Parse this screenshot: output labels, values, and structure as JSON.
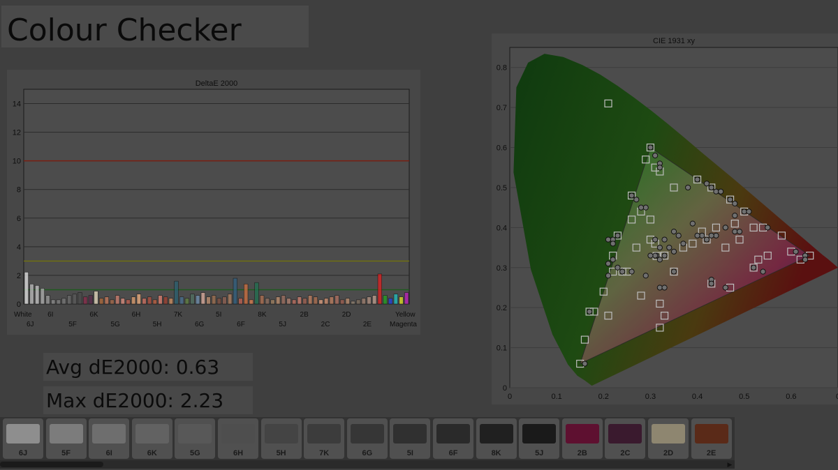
{
  "page_title": "Colour Checker",
  "stats": {
    "avg_label": "Avg dE2000: 0.63",
    "max_label": "Max dE2000: 2.23"
  },
  "chart_data": [
    {
      "type": "bar",
      "title": "DeltaE 2000",
      "ylim": [
        0,
        15
      ],
      "yticks": [
        0,
        2,
        4,
        6,
        8,
        10,
        12,
        14
      ],
      "grid": true,
      "reference_lines": [
        {
          "value": 10,
          "color": "#7a1f12"
        },
        {
          "value": 3,
          "color": "#6f6f12"
        },
        {
          "value": 1,
          "color": "#1f5a1f"
        }
      ],
      "first_label": "White",
      "last_labels": [
        "Yellow",
        "Magenta"
      ],
      "visible_tick_labels": [
        "6J",
        "6I",
        "5F",
        "6K",
        "5G",
        "6H",
        "5H",
        "7K",
        "6G",
        "5I",
        "6F",
        "8K",
        "5J",
        "2B",
        "2C",
        "2D",
        "2E"
      ],
      "bars": [
        {
          "v": 2.23,
          "c": "#e6e6e6"
        },
        {
          "v": 1.4,
          "c": "#bdbdbd"
        },
        {
          "v": 1.3,
          "c": "#c8c8c8"
        },
        {
          "v": 1.1,
          "c": "#b0b0b0"
        },
        {
          "v": 0.6,
          "c": "#9a9a9a"
        },
        {
          "v": 0.3,
          "c": "#8c8c8c"
        },
        {
          "v": 0.3,
          "c": "#808080"
        },
        {
          "v": 0.4,
          "c": "#777"
        },
        {
          "v": 0.6,
          "c": "#6a6a6a"
        },
        {
          "v": 0.7,
          "c": "#5a5a5a"
        },
        {
          "v": 0.8,
          "c": "#4a4a4a"
        },
        {
          "v": 0.5,
          "c": "#8a2a4a"
        },
        {
          "v": 0.6,
          "c": "#5a2a4a"
        },
        {
          "v": 0.9,
          "c": "#e8dcc0"
        },
        {
          "v": 0.4,
          "c": "#b06a3a"
        },
        {
          "v": 0.5,
          "c": "#c77a5a"
        },
        {
          "v": 0.3,
          "c": "#a86a4a"
        },
        {
          "v": 0.6,
          "c": "#d08070"
        },
        {
          "v": 0.4,
          "c": "#e09080"
        },
        {
          "v": 0.3,
          "c": "#c06050"
        },
        {
          "v": 0.5,
          "c": "#e0a070"
        },
        {
          "v": 0.7,
          "c": "#f0b080"
        },
        {
          "v": 0.4,
          "c": "#d07060"
        },
        {
          "v": 0.5,
          "c": "#b05040"
        },
        {
          "v": 0.3,
          "c": "#c06040"
        },
        {
          "v": 0.6,
          "c": "#e08070"
        },
        {
          "v": 0.5,
          "c": "#a04030"
        },
        {
          "v": 0.4,
          "c": "#d09060"
        },
        {
          "v": 1.6,
          "c": "#2a6070"
        },
        {
          "v": 0.5,
          "c": "#4a7090"
        },
        {
          "v": 0.4,
          "c": "#608040"
        },
        {
          "v": 0.7,
          "c": "#507060"
        },
        {
          "v": 0.6,
          "c": "#7090b0"
        },
        {
          "v": 0.8,
          "c": "#e0b0a0"
        },
        {
          "v": 0.5,
          "c": "#c09070"
        },
        {
          "v": 0.6,
          "c": "#a07050"
        },
        {
          "v": 0.4,
          "c": "#805040"
        },
        {
          "v": 0.5,
          "c": "#906050"
        },
        {
          "v": 0.7,
          "c": "#b08060"
        },
        {
          "v": 1.8,
          "c": "#306080"
        },
        {
          "v": 0.4,
          "c": "#c06050"
        },
        {
          "v": 1.4,
          "c": "#d07040"
        },
        {
          "v": 0.3,
          "c": "#e08050"
        },
        {
          "v": 1.5,
          "c": "#207050"
        },
        {
          "v": 0.6,
          "c": "#b07050"
        },
        {
          "v": 0.4,
          "c": "#907060"
        },
        {
          "v": 0.3,
          "c": "#a08060"
        },
        {
          "v": 0.5,
          "c": "#c09070"
        },
        {
          "v": 0.6,
          "c": "#a07060"
        },
        {
          "v": 0.4,
          "c": "#b08070"
        },
        {
          "v": 0.3,
          "c": "#c07060"
        },
        {
          "v": 0.5,
          "c": "#d08070"
        },
        {
          "v": 0.4,
          "c": "#a06050"
        },
        {
          "v": 0.6,
          "c": "#c08060"
        },
        {
          "v": 0.5,
          "c": "#b07050"
        },
        {
          "v": 0.3,
          "c": "#e0a080"
        },
        {
          "v": 0.4,
          "c": "#d09070"
        },
        {
          "v": 0.5,
          "c": "#c08060"
        },
        {
          "v": 0.6,
          "c": "#b07060"
        },
        {
          "v": 0.3,
          "c": "#a06050"
        },
        {
          "v": 0.4,
          "c": "#c09070"
        },
        {
          "v": 0.2,
          "c": "#908070"
        },
        {
          "v": 0.3,
          "c": "#807060"
        },
        {
          "v": 0.4,
          "c": "#a08070"
        },
        {
          "v": 0.5,
          "c": "#b09080"
        },
        {
          "v": 0.6,
          "c": "#c0a090"
        },
        {
          "v": 2.1,
          "c": "#e02020"
        },
        {
          "v": 0.6,
          "c": "#20a020"
        },
        {
          "v": 0.4,
          "c": "#2040e0"
        },
        {
          "v": 0.7,
          "c": "#20c0c0"
        },
        {
          "v": 0.5,
          "c": "#e0e020"
        },
        {
          "v": 0.8,
          "c": "#c020c0"
        }
      ]
    },
    {
      "type": "scatter",
      "title": "CIE 1931 xy",
      "xlim": [
        0,
        0.7
      ],
      "ylim": [
        0,
        0.85
      ],
      "xticks": [
        0,
        0.1,
        0.2,
        0.3,
        0.4,
        0.5,
        0.6,
        0.7
      ],
      "yticks": [
        0,
        0.1,
        0.2,
        0.3,
        0.4,
        0.5,
        0.6,
        0.7,
        0.8
      ],
      "xtick_labels": [
        "0",
        "0.1",
        "0.2",
        "0.3",
        "0.4",
        "0.5",
        "0.6",
        "0"
      ],
      "ytick_labels": [
        "0",
        "0.1",
        "0.2",
        "0.3",
        "0.4",
        "0.5",
        "0.6",
        "0.7",
        "0.8"
      ],
      "gamut_triangle": [
        [
          0.64,
          0.33
        ],
        [
          0.3,
          0.6
        ],
        [
          0.15,
          0.06
        ]
      ],
      "targets": [
        [
          0.64,
          0.33
        ],
        [
          0.3,
          0.6
        ],
        [
          0.15,
          0.06
        ],
        [
          0.313,
          0.329
        ],
        [
          0.21,
          0.71
        ],
        [
          0.17,
          0.19
        ],
        [
          0.24,
          0.29
        ],
        [
          0.27,
          0.35
        ],
        [
          0.22,
          0.33
        ],
        [
          0.26,
          0.48
        ],
        [
          0.29,
          0.57
        ],
        [
          0.31,
          0.55
        ],
        [
          0.32,
          0.54
        ],
        [
          0.35,
          0.5
        ],
        [
          0.4,
          0.52
        ],
        [
          0.43,
          0.5
        ],
        [
          0.47,
          0.47
        ],
        [
          0.5,
          0.44
        ],
        [
          0.54,
          0.4
        ],
        [
          0.58,
          0.38
        ],
        [
          0.6,
          0.34
        ],
        [
          0.62,
          0.32
        ],
        [
          0.52,
          0.3
        ],
        [
          0.47,
          0.25
        ],
        [
          0.43,
          0.26
        ],
        [
          0.32,
          0.15
        ],
        [
          0.33,
          0.18
        ],
        [
          0.32,
          0.21
        ],
        [
          0.28,
          0.23
        ],
        [
          0.2,
          0.24
        ],
        [
          0.21,
          0.18
        ],
        [
          0.18,
          0.19
        ],
        [
          0.16,
          0.12
        ],
        [
          0.22,
          0.29
        ],
        [
          0.25,
          0.29
        ],
        [
          0.35,
          0.29
        ],
        [
          0.37,
          0.35
        ],
        [
          0.39,
          0.36
        ],
        [
          0.42,
          0.37
        ],
        [
          0.46,
          0.35
        ],
        [
          0.49,
          0.37
        ],
        [
          0.55,
          0.33
        ],
        [
          0.44,
          0.4
        ],
        [
          0.48,
          0.41
        ],
        [
          0.52,
          0.4
        ],
        [
          0.41,
          0.39
        ],
        [
          0.3,
          0.42
        ],
        [
          0.28,
          0.44
        ],
        [
          0.23,
          0.38
        ],
        [
          0.26,
          0.42
        ],
        [
          0.3,
          0.37
        ],
        [
          0.31,
          0.36
        ],
        [
          0.33,
          0.33
        ],
        [
          0.53,
          0.32
        ]
      ],
      "measured": [
        [
          0.63,
          0.33
        ],
        [
          0.3,
          0.6
        ],
        [
          0.16,
          0.06
        ],
        [
          0.313,
          0.33
        ],
        [
          0.17,
          0.19
        ],
        [
          0.24,
          0.29
        ],
        [
          0.22,
          0.37
        ],
        [
          0.23,
          0.38
        ],
        [
          0.26,
          0.48
        ],
        [
          0.27,
          0.47
        ],
        [
          0.29,
          0.45
        ],
        [
          0.31,
          0.58
        ],
        [
          0.32,
          0.56
        ],
        [
          0.32,
          0.55
        ],
        [
          0.38,
          0.5
        ],
        [
          0.4,
          0.52
        ],
        [
          0.42,
          0.51
        ],
        [
          0.43,
          0.5
        ],
        [
          0.44,
          0.49
        ],
        [
          0.47,
          0.47
        ],
        [
          0.48,
          0.46
        ],
        [
          0.5,
          0.44
        ],
        [
          0.48,
          0.43
        ],
        [
          0.46,
          0.4
        ],
        [
          0.48,
          0.39
        ],
        [
          0.49,
          0.39
        ],
        [
          0.44,
          0.38
        ],
        [
          0.43,
          0.38
        ],
        [
          0.42,
          0.37
        ],
        [
          0.41,
          0.38
        ],
        [
          0.4,
          0.38
        ],
        [
          0.39,
          0.41
        ],
        [
          0.35,
          0.39
        ],
        [
          0.36,
          0.38
        ],
        [
          0.33,
          0.37
        ],
        [
          0.31,
          0.37
        ],
        [
          0.32,
          0.35
        ],
        [
          0.34,
          0.35
        ],
        [
          0.35,
          0.34
        ],
        [
          0.37,
          0.36
        ],
        [
          0.33,
          0.33
        ],
        [
          0.31,
          0.33
        ],
        [
          0.3,
          0.33
        ],
        [
          0.32,
          0.32
        ],
        [
          0.35,
          0.29
        ],
        [
          0.29,
          0.28
        ],
        [
          0.26,
          0.29
        ],
        [
          0.23,
          0.3
        ],
        [
          0.22,
          0.32
        ],
        [
          0.21,
          0.28
        ],
        [
          0.21,
          0.31
        ],
        [
          0.43,
          0.27
        ],
        [
          0.43,
          0.26
        ],
        [
          0.52,
          0.3
        ],
        [
          0.54,
          0.29
        ],
        [
          0.32,
          0.25
        ],
        [
          0.33,
          0.25
        ],
        [
          0.46,
          0.25
        ],
        [
          0.61,
          0.34
        ],
        [
          0.63,
          0.32
        ],
        [
          0.28,
          0.45
        ],
        [
          0.22,
          0.36
        ],
        [
          0.21,
          0.37
        ],
        [
          0.55,
          0.4
        ],
        [
          0.51,
          0.44
        ],
        [
          0.45,
          0.49
        ]
      ]
    }
  ],
  "swatches": [
    {
      "label": "6J",
      "color": "#8e8e8e"
    },
    {
      "label": "5F",
      "color": "#7c7c7c"
    },
    {
      "label": "6I",
      "color": "#6e6e6e"
    },
    {
      "label": "6K",
      "color": "#626262"
    },
    {
      "label": "5G",
      "color": "#585858"
    },
    {
      "label": "6H",
      "color": "#4e4e4e"
    },
    {
      "label": "5H",
      "color": "#444444"
    },
    {
      "label": "7K",
      "color": "#3c3c3c"
    },
    {
      "label": "6G",
      "color": "#363636"
    },
    {
      "label": "5I",
      "color": "#303030"
    },
    {
      "label": "6F",
      "color": "#2a2a2a"
    },
    {
      "label": "8K",
      "color": "#202020"
    },
    {
      "label": "5J",
      "color": "#1a1a1a"
    },
    {
      "label": "2B",
      "color": "#5e1030"
    },
    {
      "label": "2C",
      "color": "#3a1a2e"
    },
    {
      "label": "2D",
      "color": "#8e8670"
    },
    {
      "label": "2E",
      "color": "#5a2a18"
    }
  ],
  "scroll_arrow_icon": "triangle-right-icon"
}
